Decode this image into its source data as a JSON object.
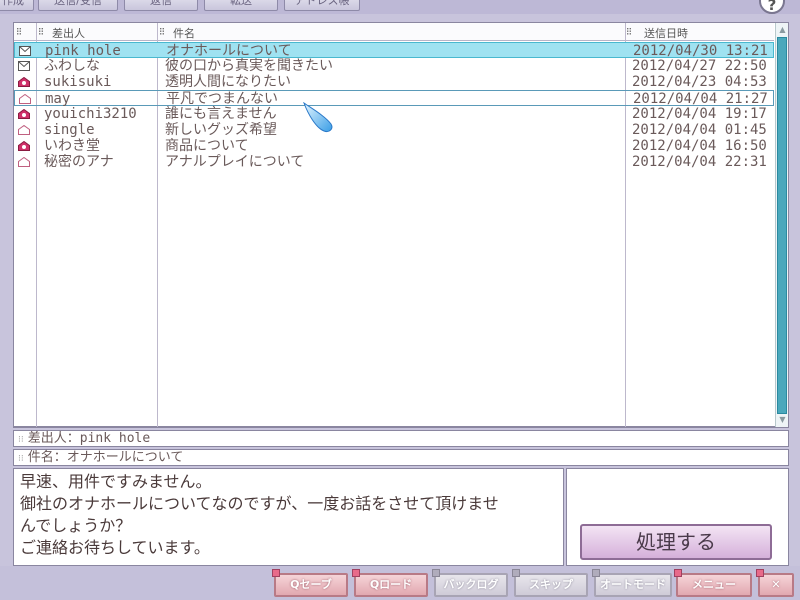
{
  "toolbar": {
    "buttons": [
      {
        "label": "作成",
        "state": "normal"
      },
      {
        "label": "送信/受信",
        "state": "normal"
      },
      {
        "label": "返信",
        "state": "normal"
      },
      {
        "label": "転送",
        "state": "normal"
      },
      {
        "label": "アドレス帳",
        "state": "normal"
      }
    ],
    "help_label": "?"
  },
  "mail_list": {
    "columns": {
      "from": "差出人",
      "subject": "件名",
      "date": "送信日時"
    },
    "rows": [
      {
        "icon": "envelope-icon",
        "from": "pink hole",
        "subject": "オナホールについて",
        "date": "2012/04/30 13:21",
        "selected": true
      },
      {
        "icon": "envelope-icon",
        "from": "ふわしな",
        "subject": "彼の口から真実を聞きたい",
        "date": "2012/04/27 22:50"
      },
      {
        "icon": "unread-mail-icon",
        "from": "sukisuki",
        "subject": "透明人間になりたい",
        "date": "2012/04/23 04:53"
      },
      {
        "icon": "open-envelope-icon",
        "from": "may",
        "subject": "平凡でつまんない",
        "date": "2012/04/04 21:27",
        "hover": true
      },
      {
        "icon": "unread-mail-icon",
        "from": "youichi3210",
        "subject": "誰にも言えません",
        "date": "2012/04/04 19:17"
      },
      {
        "icon": "open-envelope-icon",
        "from": "single",
        "subject": "新しいグッズ希望",
        "date": "2012/04/04 01:45"
      },
      {
        "icon": "unread-mail-icon",
        "from": "いわき堂",
        "subject": "商品について",
        "date": "2012/04/04 16:50"
      },
      {
        "icon": "open-envelope-icon",
        "from": "秘密のアナ",
        "subject": "アナルプレイについて",
        "date": "2012/04/04 22:31"
      }
    ]
  },
  "detail": {
    "from_label": "差出人：",
    "from_value": "pink hole",
    "subject_label": "件名：",
    "subject_value": "オナホールについて",
    "body_lines": [
      "早速、用件ですみません。",
      "御社のオナホールについてなのですが、一度お話をさせて頂けませ",
      "んでしょうか？",
      "ご連絡お待ちしています。"
    ]
  },
  "action": {
    "process_label": "処理する"
  },
  "system_menu": {
    "buttons": [
      {
        "label": "Qセーブ",
        "enabled": true
      },
      {
        "label": "Qロード",
        "enabled": true
      },
      {
        "label": "バックログ",
        "enabled": false
      },
      {
        "label": "スキップ",
        "enabled": false
      },
      {
        "label": "オートモード",
        "enabled": false
      },
      {
        "label": "メニュー",
        "enabled": true
      },
      {
        "label": "✕",
        "enabled": true
      }
    ]
  },
  "colors": {
    "background": "#c8c4dc",
    "selected_row": "#9fe2f1",
    "scroll_thumb": "#4aa8bc",
    "mail_icon_pink": "#d0306a"
  }
}
